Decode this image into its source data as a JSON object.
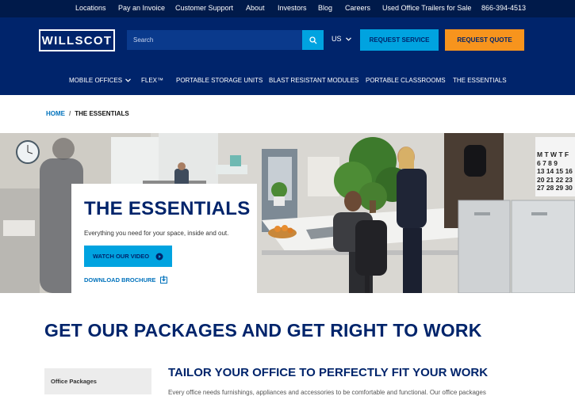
{
  "topbar": {
    "links": [
      "Locations",
      "Pay an Invoice",
      "Customer Support",
      "About",
      "Investors",
      "Blog",
      "Careers",
      "Used Office Trailers for Sale"
    ],
    "phone": "866-394-4513"
  },
  "header": {
    "logo_text": "WILLSCOT",
    "search_placeholder": "Search",
    "country": "US",
    "request_service": "REQUEST SERVICE",
    "request_quote": "REQUEST QUOTE",
    "colors": {
      "navy": "#00246b",
      "dark_navy": "#001a4a",
      "accent_blue": "#00a3e0",
      "accent_orange": "#f7941d"
    }
  },
  "nav": {
    "items": [
      "MOBILE OFFICES",
      "FLEX™",
      "PORTABLE STORAGE UNITS",
      "BLAST RESISTANT MODULES",
      "PORTABLE CLASSROOMS",
      "THE ESSENTIALS"
    ]
  },
  "breadcrumb": {
    "home": "HOME",
    "separator": "/",
    "current": "THE ESSENTIALS"
  },
  "hero": {
    "title": "THE ESSENTIALS",
    "subtitle": "Everything you need for your space, inside and out.",
    "video_button": "WATCH OUR VIDEO",
    "download_link": "DOWNLOAD BROCHURE",
    "calendar_text": [
      "M T W T F",
      "6 7 8 9",
      "13 14 15 16",
      "20 21 22 23",
      "27 28 29 30"
    ]
  },
  "packages": {
    "heading": "GET OUR PACKAGES AND GET RIGHT TO WORK",
    "side_tab": "Office Packages",
    "subheading": "TAILOR YOUR OFFICE TO PERFECTLY FIT YOUR WORK",
    "body": "Every office needs furnishings, appliances and accessories to be comfortable and functional. Our office packages"
  }
}
